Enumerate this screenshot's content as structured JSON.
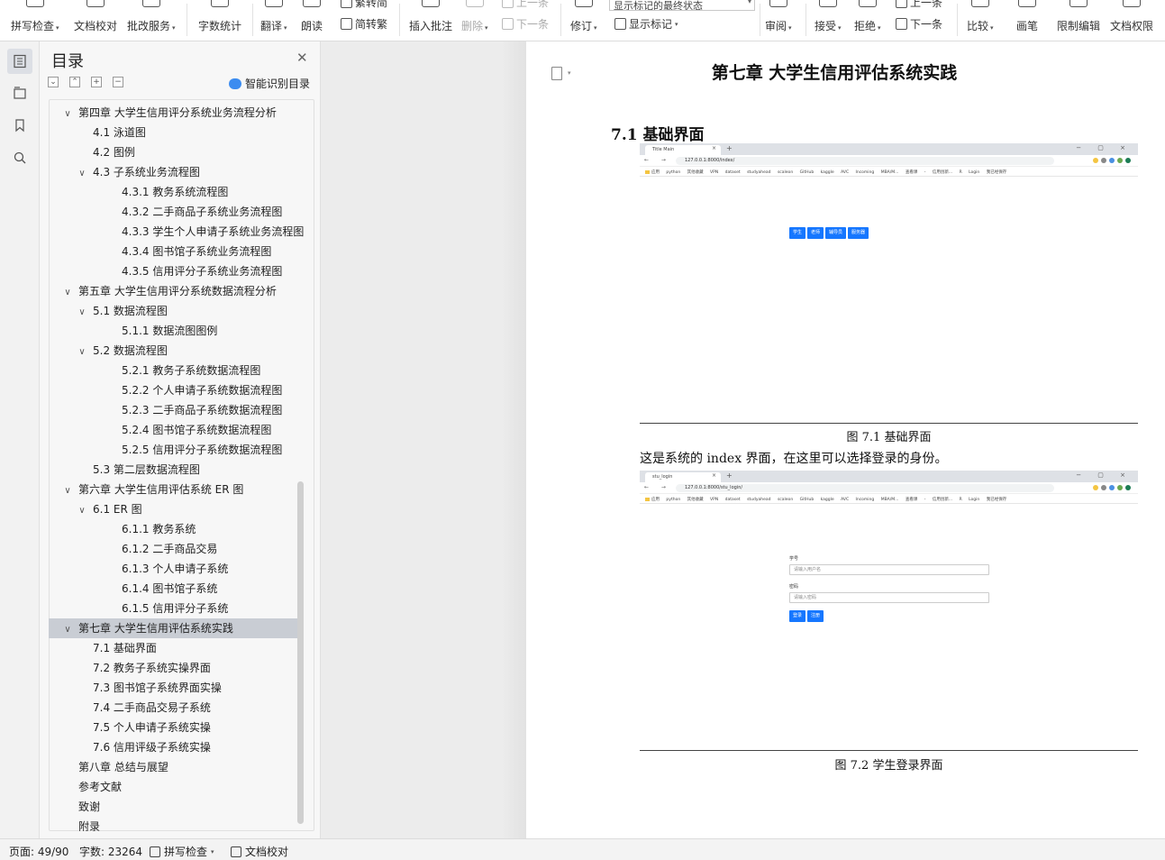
{
  "ribbon": {
    "spellcheck": "拼写检查",
    "proofread": "文档校对",
    "batch_service": "批改服务",
    "word_count": "字数统计",
    "translate": "翻译",
    "read_aloud": "朗读",
    "trad_to_simp": "繁转简",
    "simp_to_trad": "简转繁",
    "insert_comment": "插入批注",
    "delete": "删除",
    "prev_comment": "上一条",
    "next_comment": "下一条",
    "track_changes": "修订",
    "markup_mode": "显示标记的最终状态",
    "show_markup": "显示标记",
    "review": "审阅",
    "accept": "接受",
    "reject": "拒绝",
    "prev_change": "上一条",
    "next_change": "下一条",
    "compare": "比较",
    "pen": "画笔",
    "restrict_edit": "限制编辑",
    "doc_permission": "文档权限"
  },
  "toc": {
    "title": "目录",
    "smart": "智能识别目录",
    "items": [
      {
        "label": "第四章 大学生信用评分系统业务流程分析",
        "level": 1,
        "chevron": true
      },
      {
        "label": "4.1 泳道图",
        "level": 2,
        "chevron": false
      },
      {
        "label": "4.2 图例",
        "level": 2,
        "chevron": false
      },
      {
        "label": "4.3 子系统业务流程图",
        "level": 2,
        "chevron": true
      },
      {
        "label": "4.3.1 教务系统流程图",
        "level": 3,
        "chevron": false
      },
      {
        "label": "4.3.2 二手商品子系统业务流程图",
        "level": 3,
        "chevron": false
      },
      {
        "label": "4.3.3 学生个人申请子系统业务流程图",
        "level": 3,
        "chevron": false
      },
      {
        "label": "4.3.4 图书馆子系统业务流程图",
        "level": 3,
        "chevron": false
      },
      {
        "label": "4.3.5 信用评分子系统业务流程图",
        "level": 3,
        "chevron": false
      },
      {
        "label": "第五章 大学生信用评分系统数据流程分析",
        "level": 1,
        "chevron": true
      },
      {
        "label": "5.1 数据流程图",
        "level": 2,
        "chevron": true
      },
      {
        "label": "5.1.1 数据流图图例",
        "level": 3,
        "chevron": false
      },
      {
        "label": "5.2 数据流程图",
        "level": 2,
        "chevron": true
      },
      {
        "label": "5.2.1 教务子系统数据流程图",
        "level": 3,
        "chevron": false
      },
      {
        "label": "5.2.2 个人申请子系统数据流程图",
        "level": 3,
        "chevron": false
      },
      {
        "label": "5.2.3 二手商品子系统数据流程图",
        "level": 3,
        "chevron": false
      },
      {
        "label": "5.2.4 图书馆子系统数据流程图",
        "level": 3,
        "chevron": false
      },
      {
        "label": "5.2.5 信用评分子系统数据流程图",
        "level": 3,
        "chevron": false
      },
      {
        "label": "5.3 第二层数据流程图",
        "level": 2,
        "chevron": false
      },
      {
        "label": "第六章 大学生信用评估系统 ER 图",
        "level": 1,
        "chevron": true
      },
      {
        "label": "6.1 ER 图",
        "level": 2,
        "chevron": true
      },
      {
        "label": "6.1.1 教务系统",
        "level": 3,
        "chevron": false
      },
      {
        "label": "6.1.2 二手商品交易",
        "level": 3,
        "chevron": false
      },
      {
        "label": "6.1.3 个人申请子系统",
        "level": 3,
        "chevron": false
      },
      {
        "label": "6.1.4 图书馆子系统",
        "level": 3,
        "chevron": false
      },
      {
        "label": "6.1.5 信用评分子系统",
        "level": 3,
        "chevron": false
      },
      {
        "label": "第七章 大学生信用评估系统实践",
        "level": 1,
        "chevron": true,
        "active": true
      },
      {
        "label": "7.1 基础界面",
        "level": 2,
        "chevron": false
      },
      {
        "label": "7.2 教务子系统实操界面",
        "level": 2,
        "chevron": false
      },
      {
        "label": "7.3 图书馆子系统界面实操",
        "level": 2,
        "chevron": false
      },
      {
        "label": "7.4 二手商品交易子系统",
        "level": 2,
        "chevron": false
      },
      {
        "label": "7.5 个人申请子系统实操",
        "level": 2,
        "chevron": false
      },
      {
        "label": "7.6 信用评级子系统实操",
        "level": 2,
        "chevron": false
      },
      {
        "label": "第八章 总结与展望",
        "level": 1,
        "chevron": false
      },
      {
        "label": "参考文献",
        "level": 1,
        "chevron": false
      },
      {
        "label": "致谢",
        "level": 1,
        "chevron": false
      },
      {
        "label": "附录",
        "level": 1,
        "chevron": false
      }
    ]
  },
  "doc": {
    "chapter_title": "第七章 大学生信用评估系统实践",
    "section_title": "7.1 基础界面",
    "fig1_caption": "图 7.1 基础界面",
    "para": "这是系统的 index 界面，在这里可以选择登录的身份。",
    "fig2_caption": "图 7.2 学生登录界面",
    "shot1": {
      "tab": "Title Main",
      "url": "127.0.0.1:8000/index/",
      "buttons": [
        "学生",
        "老师",
        "辅导员",
        "服务器"
      ]
    },
    "shot2": {
      "tab": "stu_login",
      "url": "127.0.0.1:8000/stu_login/",
      "user_label": "学号",
      "user_placeholder": "请输入用户名",
      "pwd_label": "密码",
      "pwd_placeholder": "请输入密码",
      "buttons": [
        "登录",
        "注册"
      ]
    },
    "bookmarks": "应用  python  其他收藏  VPN  dataset  studyahead  scaleon  GitHub  kaggle  AVC  Incoming MBA/M...  查看课 - 信用创新...  R  Login  我已经保存"
  },
  "status": {
    "page": "页面: 49/90",
    "words": "字数: 23264",
    "spellcheck": "拼写检查",
    "proofread": "文档校对"
  }
}
